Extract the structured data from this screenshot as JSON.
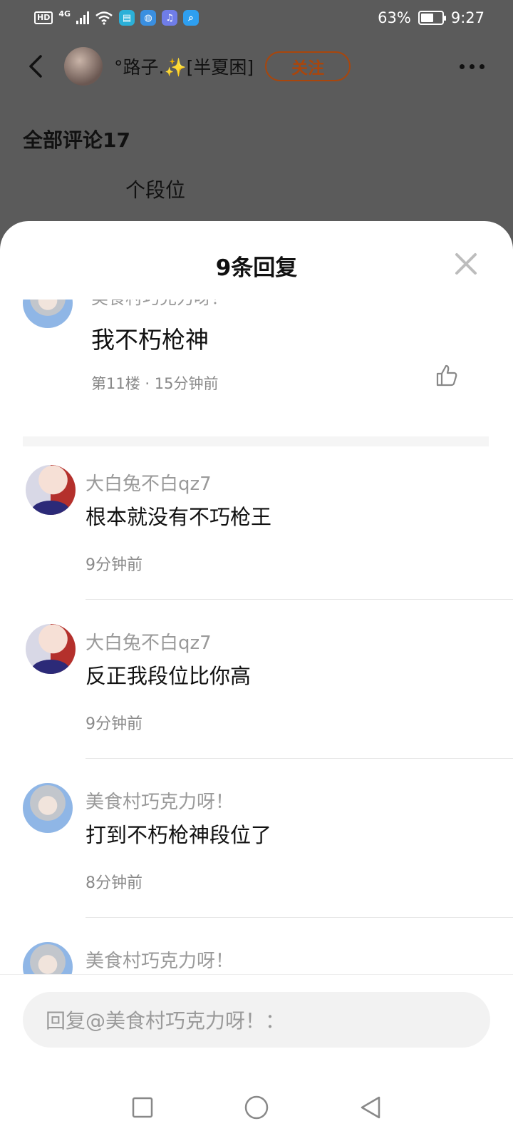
{
  "status_bar": {
    "hd": "HD",
    "network": "4G",
    "battery_percent": "63%",
    "battery_level": 0.63,
    "time": "9:27"
  },
  "header": {
    "user_name": "°路子.",
    "user_sparkle": "✨",
    "user_tag": "[半夏困]",
    "follow_label": "关注",
    "follow_color": "#a9460c"
  },
  "background": {
    "all_comments": "全部评论17",
    "partial_text": "个段位"
  },
  "sheet": {
    "title": "9条回复"
  },
  "main_comment": {
    "user": "美食村巧克力呀！",
    "text": "我不朽枪神",
    "meta": "第11楼 · 15分钟前"
  },
  "replies": [
    {
      "user": "大白兔不白qz7",
      "text": "根本就没有不巧枪王",
      "time": "9分钟前",
      "avatar": "boy"
    },
    {
      "user": "大白兔不白qz7",
      "text": "反正我段位比你高",
      "time": "9分钟前",
      "avatar": "boy"
    },
    {
      "user": "美食村巧克力呀！",
      "text": "打到不朽枪神段位了",
      "time": "8分钟前",
      "avatar": "grey"
    },
    {
      "user": "美食村巧克力呀！",
      "text": "",
      "time": "",
      "avatar": "grey"
    }
  ],
  "input": {
    "placeholder": "回复@美食村巧克力呀！："
  }
}
